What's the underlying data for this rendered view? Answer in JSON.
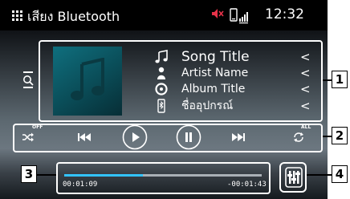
{
  "header": {
    "title": "เสียง Bluetooth",
    "clock": "12:32",
    "menu_icon": "grid-menu-icon",
    "status_icons": [
      "mute-icon",
      "phone-signal-icon"
    ]
  },
  "track": {
    "song_title": "Song Title",
    "artist_name": "Artist Name",
    "album_title": "Album Title",
    "device_name": "ชื่ออุปกรณ์"
  },
  "controls": {
    "shuffle_label": "OFF",
    "repeat_label": "ALL"
  },
  "progress": {
    "elapsed": "00:01:09",
    "remaining": "-00:01:43",
    "fraction": 0.4
  },
  "callouts": {
    "c1": "1",
    "c2": "2",
    "c3": "3",
    "c4": "4"
  },
  "colors": {
    "accent": "#32c3ff",
    "mute": "#e8334a",
    "album_art": "#0a4c57"
  }
}
